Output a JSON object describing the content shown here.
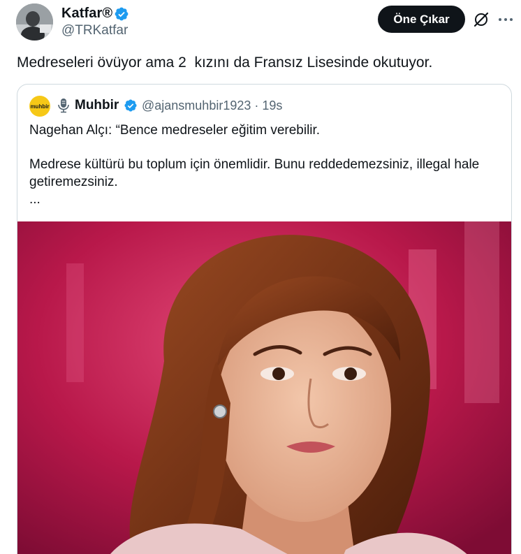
{
  "author": {
    "name": "Katfar®",
    "handle": "@TRKatfar",
    "verified_icon": "verified-badge-icon"
  },
  "actions": {
    "feature_label": "Öne Çıkar",
    "grok_icon": "grok-slash-icon",
    "more_icon": "more-dots-icon"
  },
  "tweet": {
    "text": "Medreseleri övüyor ama 2  kızını da Fransız Lisesinde okutuyor."
  },
  "quoted": {
    "avatar_text": "muhbir",
    "avatar_color": "#f6c817",
    "mic_icon": "microphone-icon",
    "name": "Muhbir",
    "handle": "@ajansmuhbir1923",
    "separator": "·",
    "time": "19s",
    "lines": [
      "Nagehan Alçı: “Bence medreseler eğitim verebilir.",
      "Medrese kültürü bu toplum için önemlidir. Bunu reddedemezsiniz, illegal hale getiremezsiniz.",
      "..."
    ],
    "image_subject": "woman-portrait-photo"
  },
  "colors": {
    "verified": "#1d9bf0",
    "secondary_text": "#536471",
    "button_bg": "#0f1419",
    "border": "#cfd9de",
    "photo_bg": "#b8184a"
  }
}
